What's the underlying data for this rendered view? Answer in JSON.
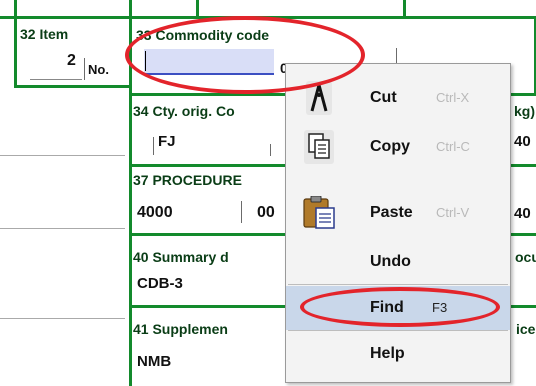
{
  "form": {
    "box32": {
      "label": "32 Item",
      "value": "2",
      "unit": "No."
    },
    "box33": {
      "label": "33 Commodity code",
      "input_value": "",
      "partial_right": "00"
    },
    "box34": {
      "label": "34 Cty. orig. Co",
      "value": "FJ",
      "right_label": "kg)",
      "right_value": "40"
    },
    "box37": {
      "label": "37 PROCEDURE",
      "value1": "4000",
      "value2": "00",
      "right_value": "40"
    },
    "box40": {
      "label": "40 Summary d",
      "value": "CDB-3",
      "right_label": "ocu"
    },
    "box41": {
      "label": "41 Supplemen",
      "value": "NMB",
      "right_label": "ice"
    }
  },
  "context_menu": {
    "items": [
      {
        "label": "Cut",
        "shortcut": "Ctrl-X",
        "icon": "scissors-icon"
      },
      {
        "label": "Copy",
        "shortcut": "Ctrl-C",
        "icon": "copy-icon"
      },
      {
        "label": "Paste",
        "shortcut": "Ctrl-V",
        "icon": "paste-icon"
      },
      {
        "label": "Undo",
        "shortcut": ""
      },
      {
        "label": "Find",
        "shortcut": "F3",
        "highlighted": true
      },
      {
        "label": "Help",
        "shortcut": ""
      }
    ]
  },
  "colors": {
    "grid": "#138a2c",
    "highlight_oval": "#e3242b",
    "input_bg": "#d9def7",
    "menu_hover": "#c9d7ea"
  }
}
